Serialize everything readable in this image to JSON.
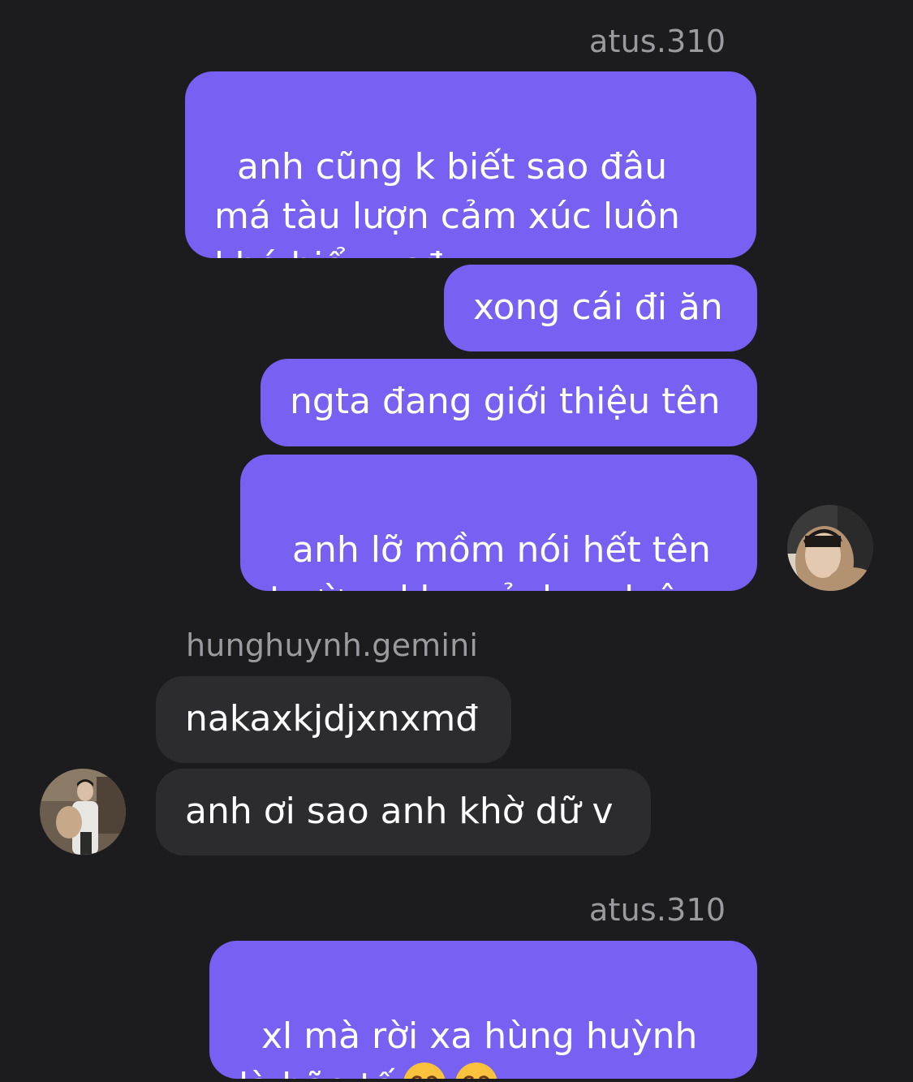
{
  "thread": {
    "messages": [
      {
        "sender": "atus.310"
      },
      {
        "text": "anh cũng k biết sao đâu má tàu lượn cảm xúc luôn khó hiểu vcđ"
      },
      {
        "text": "xong cái đi ăn"
      },
      {
        "text": "ngta đang giới thiệu tên"
      },
      {
        "text": "anh lỡ mồm nói hết tên trường khoa ảnh ra luôn-"
      },
      {
        "sender": "hunghuynh.gemini"
      },
      {
        "text": "nakaxkjdjxnxmđ"
      },
      {
        "text": "anh ơi sao anh khờ dữ v"
      },
      {
        "sender": "atus.310"
      },
      {
        "text": "xl mà rời xa hùng huỳnh là bão tố"
      }
    ]
  },
  "emojis": [
    "loudly-crying-face-icon",
    "loudly-crying-face-icon"
  ],
  "colors": {
    "background": "#1c1c1e",
    "outgoing_bubble": "#7860f2",
    "incoming_bubble": "#2c2c2e",
    "sender_label": "#9a9a9f"
  }
}
